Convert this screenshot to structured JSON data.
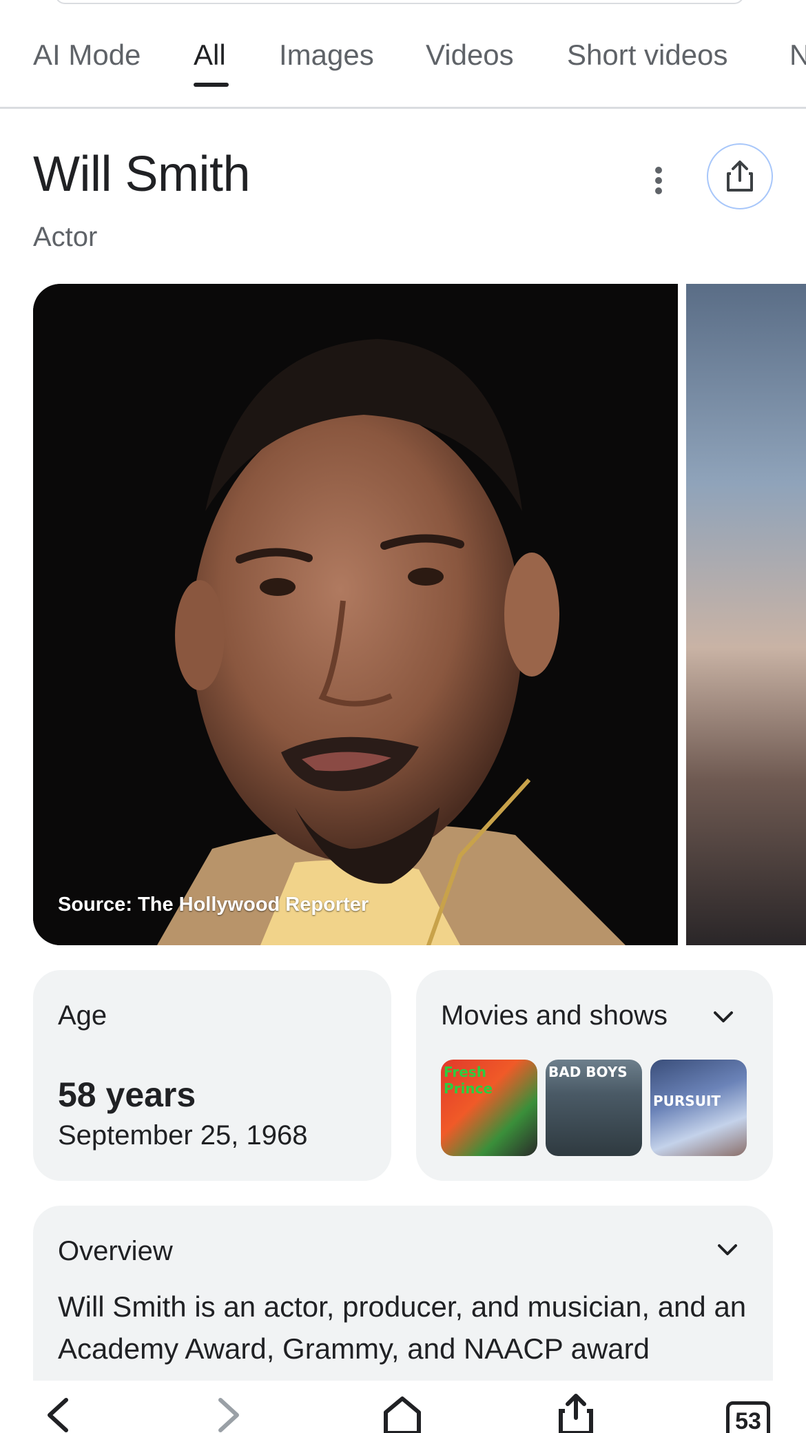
{
  "tabs": [
    {
      "label": "AI Mode"
    },
    {
      "label": "All"
    },
    {
      "label": "Images"
    },
    {
      "label": "Videos"
    },
    {
      "label": "Short videos"
    },
    {
      "label": "N"
    }
  ],
  "active_tab": "All",
  "entity": {
    "title": "Will Smith",
    "subtitle": "Actor"
  },
  "image": {
    "caption": "Source: The Hollywood Reporter"
  },
  "age_card": {
    "label": "Age",
    "value": "58 years",
    "date": "September 25, 1968"
  },
  "movies_card": {
    "label": "Movies and shows",
    "posters": [
      {
        "tag": "Fresh Prince"
      },
      {
        "tag": "BAD BOYS"
      },
      {
        "tag": "PURSUIT"
      }
    ]
  },
  "overview_card": {
    "label": "Overview",
    "text": "Will Smith is an actor, producer, and musician, and an Academy Award, Grammy, and NAACP award"
  },
  "bottom_nav": {
    "tab_count": "53"
  },
  "colors": {
    "accent_border": "#a8c7fa",
    "card_bg": "#f1f3f4",
    "text_primary": "#202124",
    "text_secondary": "#5f6368"
  },
  "icons": [
    "more-vert-icon",
    "share-icon",
    "chevron-down-icon",
    "back-icon",
    "forward-icon",
    "home-icon",
    "share-icon",
    "tabs-icon"
  ]
}
